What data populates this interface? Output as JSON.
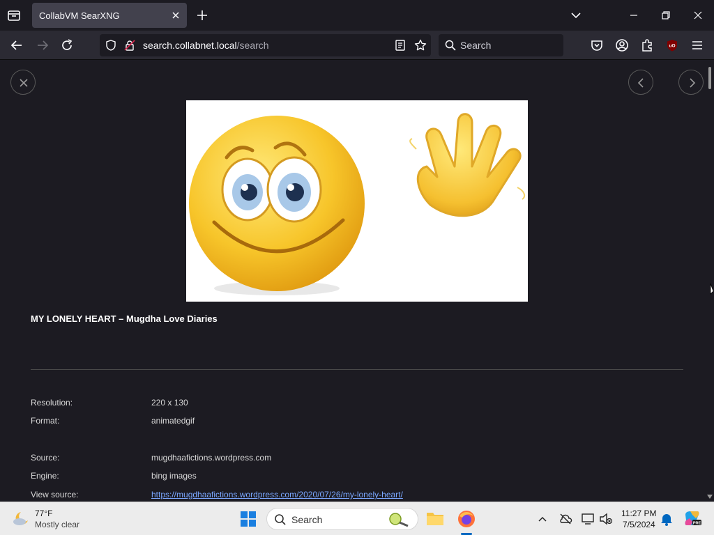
{
  "browser": {
    "tab": {
      "title": "CollabVM SearXNG"
    },
    "url": {
      "host": "search.collabnet.local",
      "path": "/search"
    },
    "search_placeholder": "Search"
  },
  "image_view": {
    "title": "MY LONELY HEART – Mugdha Love Diaries",
    "fields": [
      {
        "label": "Resolution:",
        "value": "220 x 130"
      },
      {
        "label": "Format:",
        "value": "animatedgif"
      },
      {
        "label": "Source:",
        "value": "mugdhaafictions.wordpress.com"
      },
      {
        "label": "Engine:",
        "value": "bing images"
      },
      {
        "label": "View source:",
        "value": "https://mugdhaafictions.wordpress.com/2020/07/26/my-lonely-heart/"
      }
    ]
  },
  "taskbar": {
    "weather": {
      "temp": "77°F",
      "desc": "Mostly clear"
    },
    "search_label": "Search",
    "clock": {
      "time": "11:27 PM",
      "date": "7/5/2024"
    }
  },
  "colors": {
    "browser_bg": "#1c1b22",
    "toolbar_bg": "#2b2a33",
    "link": "#7aa7ff",
    "taskbar_bg": "#ececec"
  }
}
